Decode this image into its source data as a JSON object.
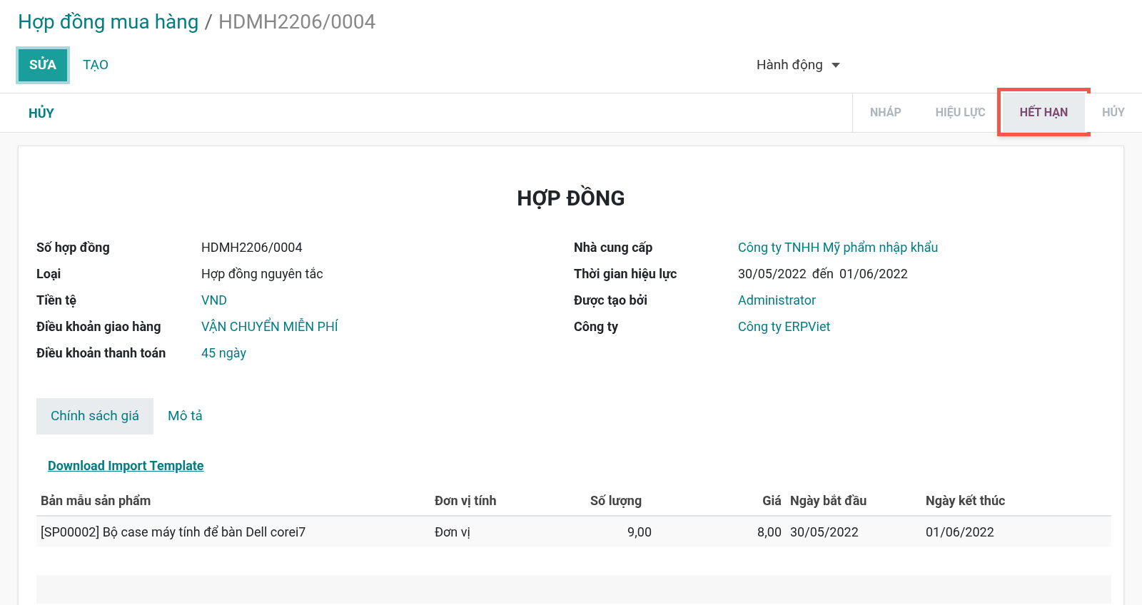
{
  "breadcrumb": {
    "parent": "Hợp đồng mua hàng",
    "separator": "/",
    "current": "HDMH2206/0004"
  },
  "buttons": [
    {
      "label": "SỬA",
      "kind": "primary"
    },
    {
      "label": "TẠO",
      "kind": "link"
    }
  ],
  "action_menu": {
    "label": "Hành động"
  },
  "status_buttons": [
    "HỦY"
  ],
  "stages": [
    {
      "label": "NHÁP",
      "selected": false,
      "highlighted": false
    },
    {
      "label": "HIỆU LỰC",
      "selected": false,
      "highlighted": false
    },
    {
      "label": "HẾT HẠN",
      "selected": true,
      "highlighted": true
    },
    {
      "label": "HỦY",
      "selected": false,
      "highlighted": false
    }
  ],
  "form": {
    "title": "HỢP ĐỒNG",
    "left_fields": [
      {
        "label": "Số hợp đồng",
        "values": [
          "HDMH2206/0004"
        ],
        "link": false
      },
      {
        "label": "Loại",
        "values": [
          "Hợp đồng nguyên tắc"
        ],
        "link": false
      },
      {
        "label": "Tiền tệ",
        "values": [
          "VND"
        ],
        "link": true
      },
      {
        "label": "Điều khoản giao hàng",
        "values": [
          "VẬN CHUYỂN MIỄN PHÍ"
        ],
        "link": true
      },
      {
        "label": "Điều khoản thanh toán",
        "values": [
          "45 ngày"
        ],
        "link": true
      }
    ],
    "right_fields": [
      {
        "label": "Nhà cung cấp",
        "values": [
          "Công ty TNHH Mỹ phẩm nhập khẩu"
        ],
        "link": true
      },
      {
        "label": "Thời gian hiệu lực",
        "values": [
          "30/05/2022",
          "đến",
          "01/06/2022"
        ],
        "link": false
      },
      {
        "label": "Được tạo bởi",
        "values": [
          "Administrator"
        ],
        "link": true
      },
      {
        "label": "Công ty",
        "values": [
          "Công ty ERPViet"
        ],
        "link": true
      }
    ],
    "tabs": [
      {
        "label": "Chính sách giá",
        "selected": true
      },
      {
        "label": "Mô tả",
        "selected": false
      }
    ],
    "download_link": "Download Import Template",
    "table": {
      "columns": [
        "Bản mẫu sản phẩm",
        "Đơn vị tính",
        "Số lượng",
        "Giá",
        "Ngày bắt đầu",
        "Ngày kết thúc"
      ],
      "rows": [
        [
          "[SP00002] Bộ case máy tính để bàn Dell corei7",
          "Đơn vị",
          "9,00",
          "8,00",
          "30/05/2022",
          "01/06/2022"
        ]
      ]
    }
  }
}
